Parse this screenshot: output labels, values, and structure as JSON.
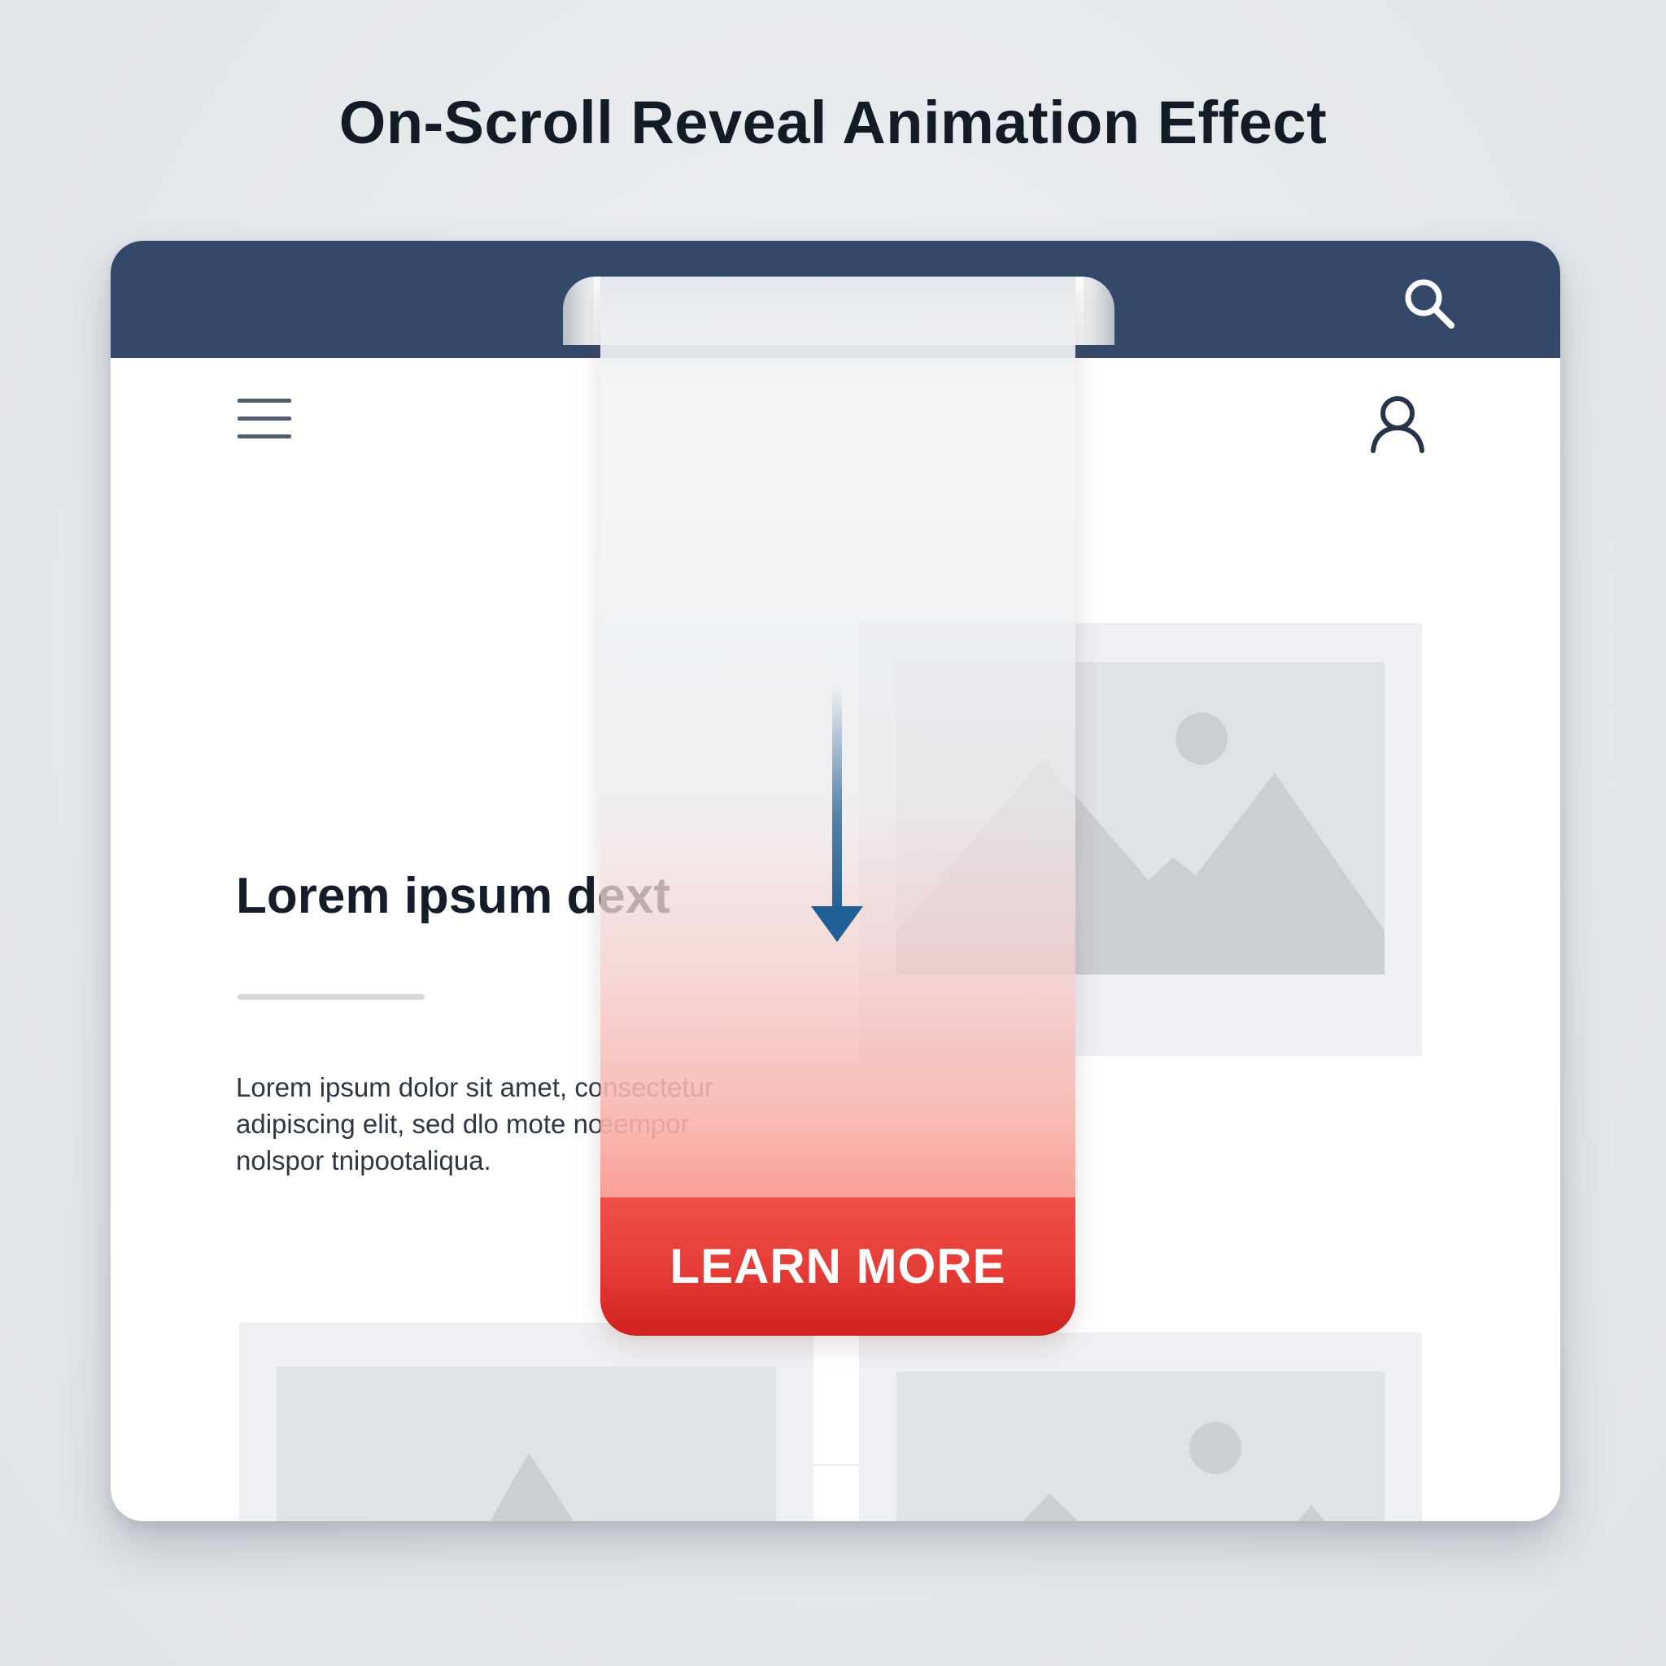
{
  "header": {
    "title": "On-Scroll Reveal Animation Effect"
  },
  "browser": {
    "icons": {
      "search": "search-icon",
      "menu": "hamburger-menu-icon",
      "user": "user-icon"
    }
  },
  "content": {
    "heading": "Lorem ipsum dext",
    "paragraph_lines": [
      "Lorem ipsum dolor sit amet, consectetur",
      "adipiscing elit, sed dlo mote nœempor",
      "nolspor tnipootaliqua."
    ]
  },
  "ribbon": {
    "cta_label": "LEARN MORE",
    "direction": "down"
  },
  "colors": {
    "topbar": "#34496a",
    "cta": "#e43b36",
    "arrow": "#1f5f94",
    "background": "#e8eaed"
  }
}
